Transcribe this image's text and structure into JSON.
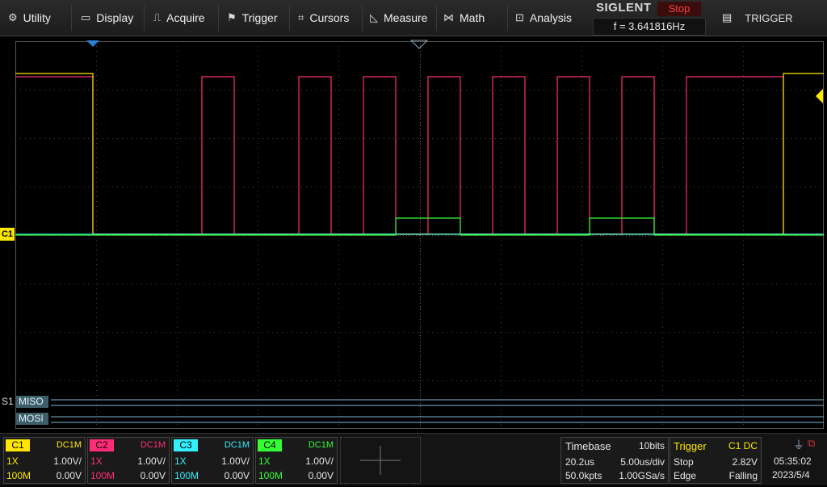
{
  "menu": [
    {
      "icon": "gear-icon",
      "label": "Utility"
    },
    {
      "icon": "display-icon",
      "label": "Display"
    },
    {
      "icon": "acquire-icon",
      "label": "Acquire"
    },
    {
      "icon": "trigger-flag-icon",
      "label": "Trigger"
    },
    {
      "icon": "cursors-icon",
      "label": "Cursors"
    },
    {
      "icon": "measure-icon",
      "label": "Measure"
    },
    {
      "icon": "math-icon",
      "label": "Math"
    },
    {
      "icon": "analysis-icon",
      "label": "Analysis"
    }
  ],
  "brand": {
    "logo": "SIGLENT",
    "status": "Stop",
    "frequency": "f = 3.641816Hz"
  },
  "trigger_menu": {
    "icon": "menu-icon",
    "label": "TRIGGER"
  },
  "plot": {
    "channel_marker": "C1",
    "serial_label": "S1",
    "bus_lines": [
      "MISO",
      "MOSI"
    ]
  },
  "channels": [
    {
      "name": "C1",
      "color": "#ffe600",
      "coupling": "DC1M",
      "probe": "1X",
      "scale": "1.00V/",
      "bandwidth": "100M",
      "offset": "0.00V"
    },
    {
      "name": "C2",
      "color": "#ff2d78",
      "coupling": "DC1M",
      "probe": "1X",
      "scale": "1.00V/",
      "bandwidth": "100M",
      "offset": "0.00V"
    },
    {
      "name": "C3",
      "color": "#33f0ff",
      "coupling": "DC1M",
      "probe": "1X",
      "scale": "1.00V/",
      "bandwidth": "100M",
      "offset": "0.00V"
    },
    {
      "name": "C4",
      "color": "#33ff33",
      "coupling": "DC1M",
      "probe": "1X",
      "scale": "1.00V/",
      "bandwidth": "100M",
      "offset": "0.00V"
    }
  ],
  "timebase": {
    "title": "Timebase",
    "bits": "10bits",
    "delay": "20.2us",
    "scale": "5.00us/div",
    "points": "50.0kpts",
    "rate": "1.00GSa/s"
  },
  "trigger": {
    "title": "Trigger",
    "source": "C1 DC",
    "mode": "Stop",
    "level": "2.82V",
    "type": "Edge",
    "slope": "Falling"
  },
  "clock": {
    "time": "05:35:02",
    "date": "2023/5/4"
  }
}
